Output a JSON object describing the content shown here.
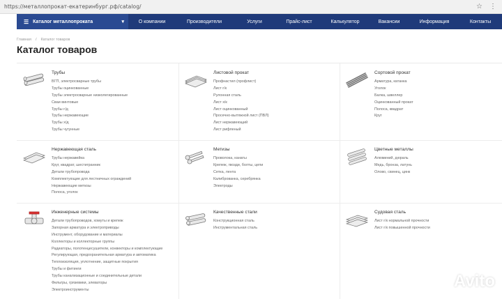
{
  "browser": {
    "url": "https://металлопрокат-екатеринбург.рф/catalog/"
  },
  "nav": {
    "catalog_label": "Каталог металлопроката",
    "items": [
      "О компании",
      "Производители",
      "Услуги",
      "Прайс-лист",
      "Калькулятор",
      "Вакансии",
      "Информация",
      "Контакты"
    ]
  },
  "breadcrumb": [
    "Главная",
    "/",
    "Каталог товаров"
  ],
  "page_title": "Каталог товаров",
  "categories": [
    {
      "title": "Трубы",
      "icon": "pipes-icon",
      "items": [
        "ВГП, электросварные трубы",
        "Трубы оцинкованные",
        "Трубы электросварные низколегированные",
        "Сваи винтовые",
        "Трубы г/д",
        "Трубы нержавеющие",
        "Трубы х/д",
        "Трубы чугунные"
      ]
    },
    {
      "title": "Листовой прокат",
      "icon": "sheet-metal-icon",
      "items": [
        "Профнастил (профлист)",
        "Лист г/к",
        "Рулонная сталь",
        "Лист х/к",
        "Лист оцинкованный",
        "Просечно-вытяжной лист (ПВЛ)",
        "Лист нержавеющий",
        "Лист рифленый"
      ]
    },
    {
      "title": "Сортовой прокат",
      "icon": "rebar-icon",
      "items": [
        "Арматура, катанка",
        "Уголок",
        "Балка, швеллер",
        "Оцинкованный прокат",
        "Полоса, квадрат",
        "Круг"
      ]
    },
    {
      "title": "Нержавеющая сталь",
      "icon": "stainless-icon",
      "items": [
        "Трубы нержавейка",
        "Круг, квадрат, шестигранник",
        "Детали трубопровода",
        "Комплектующие для лестничных ограждений",
        "Нержавеющие метизы",
        "Полоса, уголок"
      ]
    },
    {
      "title": "Метизы",
      "icon": "fasteners-icon",
      "items": [
        "Проволока, канаты",
        "Крепеж, гвозди, болты, цепи",
        "Сетка, лента",
        "Калиброванка, серебрянка",
        "Электроды"
      ]
    },
    {
      "title": "Цветные металлы",
      "icon": "nonferrous-icon",
      "items": [
        "Алюминий, дюраль",
        "Медь, бронза, латунь",
        "Олово, свинец, цинк"
      ]
    },
    {
      "title": "Инженерные системы",
      "icon": "valve-icon",
      "items": [
        "Детали трубопроводов, хомуты и крепеж",
        "Запорная арматура и электроприводы",
        "Инструмент, оборудование и материалы",
        "Коллекторы и коллекторные группы",
        "Радиаторы, полотенцесушители, конвекторы и комплектующие",
        "Регулирующая, предохранительная арматура и автоматика",
        "Теплоизоляция, уплотнение, защитные покрытия",
        "Трубы и фитинги",
        "Трубы канализационные и соединительные детали",
        "Фильтры, грязевики, элеваторы",
        "Электроинструменты"
      ]
    },
    {
      "title": "Качественные стали",
      "icon": "quality-steel-icon",
      "items": [
        "Конструкционная сталь",
        "Инструментальная сталь"
      ]
    },
    {
      "title": "Судовая сталь",
      "icon": "ship-steel-icon",
      "items": [
        "Лист г/к нормальной прочности",
        "Лист г/к повышенной прочности"
      ]
    }
  ],
  "watermark": {
    "text": "Avito",
    "icon": "avito-logo-icon"
  },
  "colors": {
    "nav_bg": "#1f3a7a",
    "nav_catalog_bg": "#2a4a92"
  }
}
